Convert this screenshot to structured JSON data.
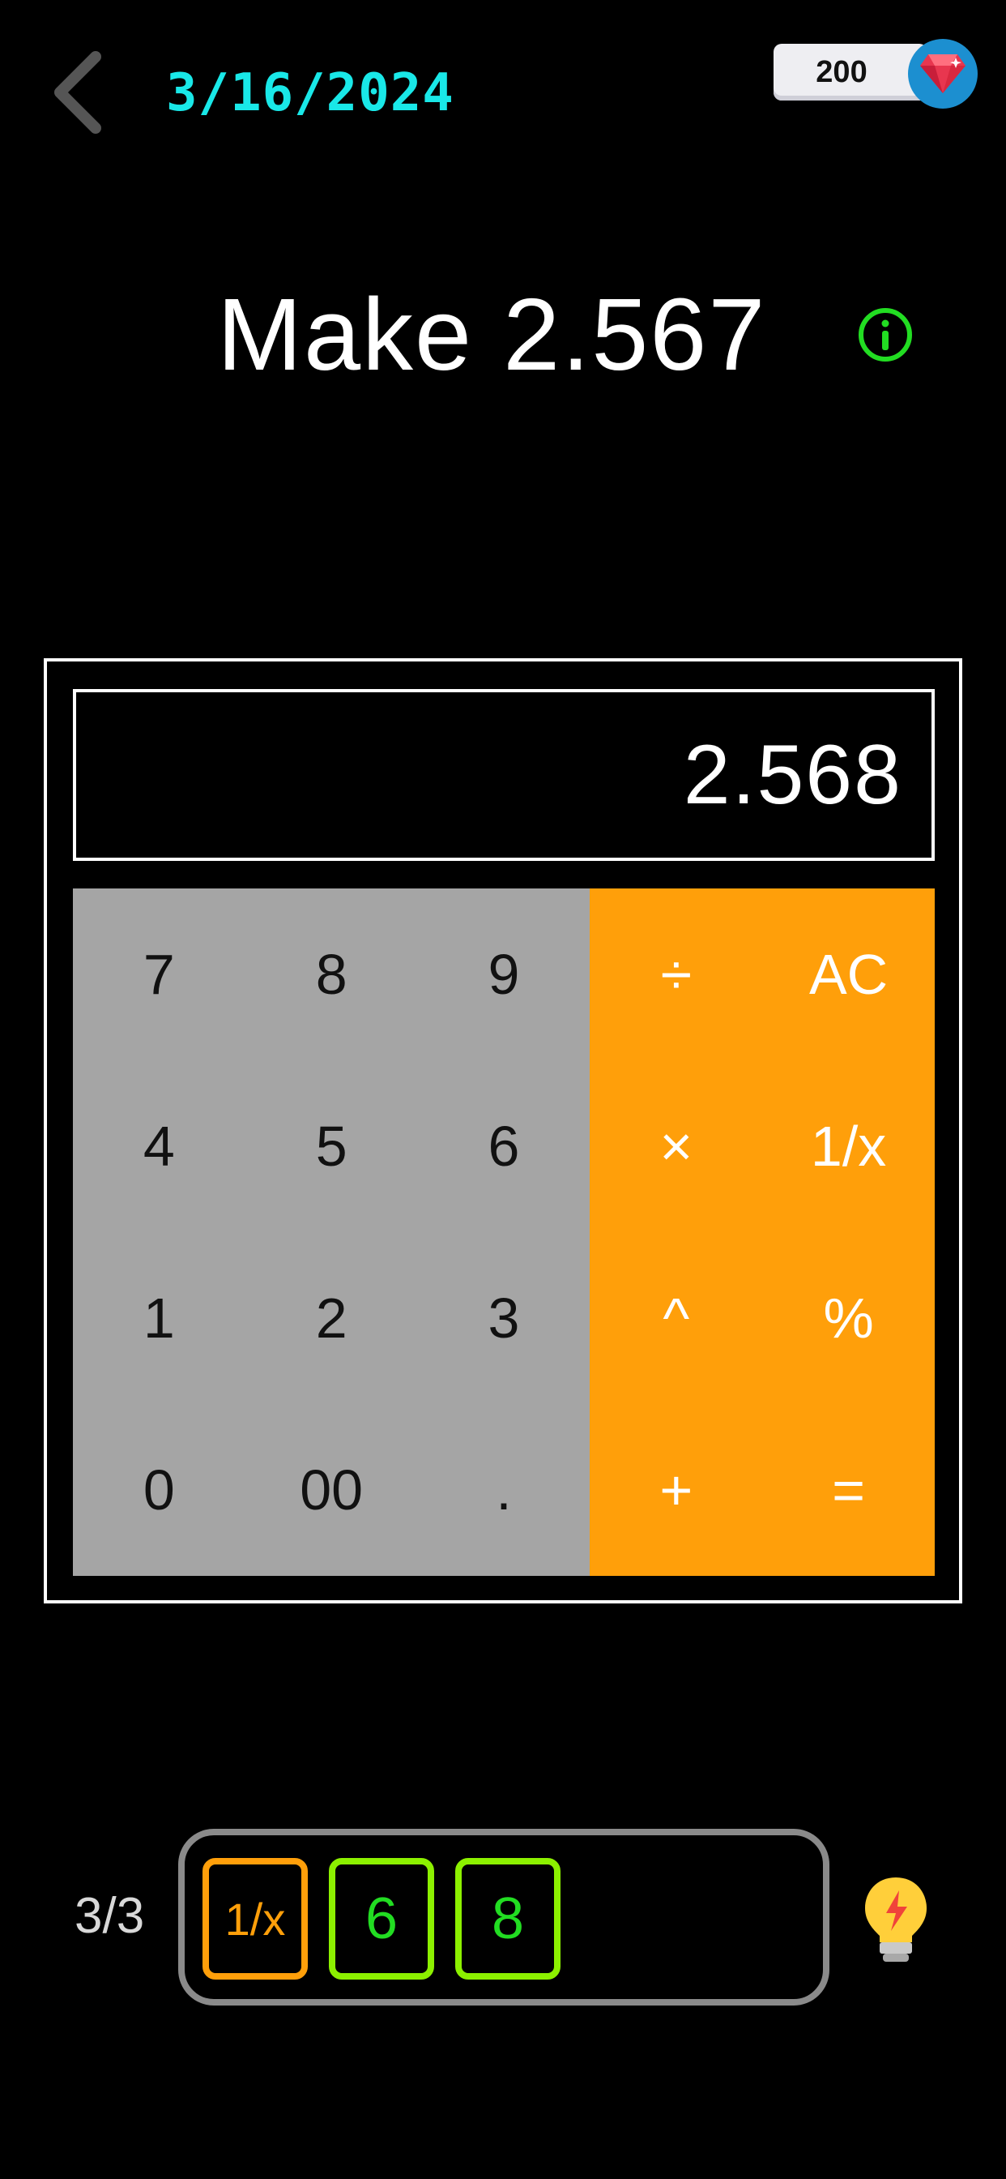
{
  "header": {
    "back_icon": "chevron-left-icon",
    "date": "3/16/2024",
    "gem_count": "200",
    "gem_icon": "gem-icon"
  },
  "puzzle": {
    "target": "Make 2.567",
    "info_icon": "info-icon"
  },
  "calculator": {
    "display": "2.568",
    "keys": [
      {
        "label": "7",
        "kind": "num"
      },
      {
        "label": "8",
        "kind": "num"
      },
      {
        "label": "9",
        "kind": "num"
      },
      {
        "label": "÷",
        "kind": "op"
      },
      {
        "label": "AC",
        "kind": "op"
      },
      {
        "label": "4",
        "kind": "num"
      },
      {
        "label": "5",
        "kind": "num"
      },
      {
        "label": "6",
        "kind": "num"
      },
      {
        "label": "×",
        "kind": "op"
      },
      {
        "label": "1/x",
        "kind": "op"
      },
      {
        "label": "1",
        "kind": "num"
      },
      {
        "label": "2",
        "kind": "num"
      },
      {
        "label": "3",
        "kind": "num"
      },
      {
        "label": "^",
        "kind": "op"
      },
      {
        "label": "%",
        "kind": "op"
      },
      {
        "label": "0",
        "kind": "num"
      },
      {
        "label": "00",
        "kind": "num"
      },
      {
        "label": ".",
        "kind": "num"
      },
      {
        "label": "+",
        "kind": "op"
      },
      {
        "label": "=",
        "kind": "op"
      }
    ],
    "colors": {
      "number_key": "#a5a5a5",
      "operator_key": "#ff9f0a"
    }
  },
  "moves": {
    "counter": "3/3",
    "used": [
      {
        "label": "1/x",
        "kind": "op"
      },
      {
        "label": "6",
        "kind": "num"
      },
      {
        "label": "8",
        "kind": "num"
      }
    ],
    "hint_icon": "lightbulb-icon"
  }
}
